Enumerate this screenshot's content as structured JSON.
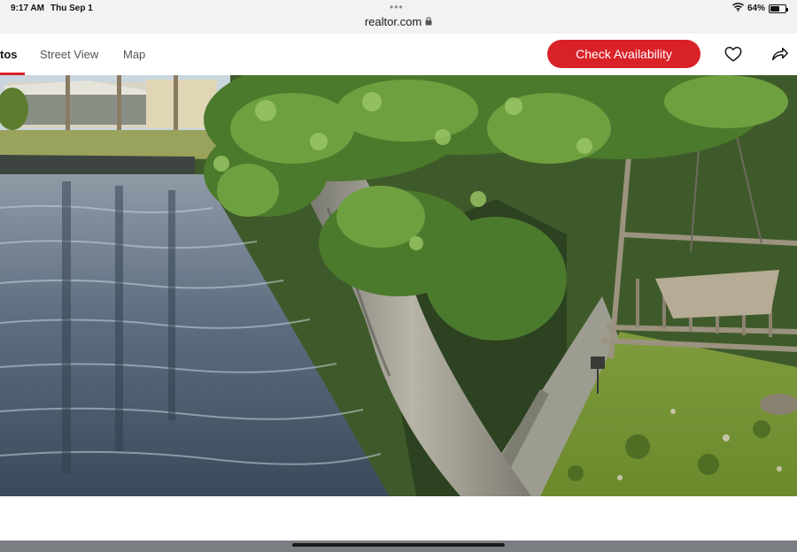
{
  "status_bar": {
    "time": "9:17 AM",
    "date": "Thu Sep 1",
    "url": "realtor.com",
    "battery": "64%",
    "battery_level": 0.64,
    "icons": [
      "wifi-icon",
      "battery-icon",
      "lock-icon",
      "more-dots-icon"
    ]
  },
  "nav": {
    "tabs": [
      {
        "label": "tos",
        "active": true
      },
      {
        "label": "Street View",
        "active": false
      },
      {
        "label": "Map",
        "active": false
      }
    ],
    "check_availability": "Check Availability",
    "icons": [
      "heart-icon",
      "share-icon"
    ]
  },
  "photo": {
    "subject": "canal-with-tree-and-wooden-swing"
  },
  "colors": {
    "accent": "#d92228",
    "status_bar_bg": "#f2f2f4"
  }
}
